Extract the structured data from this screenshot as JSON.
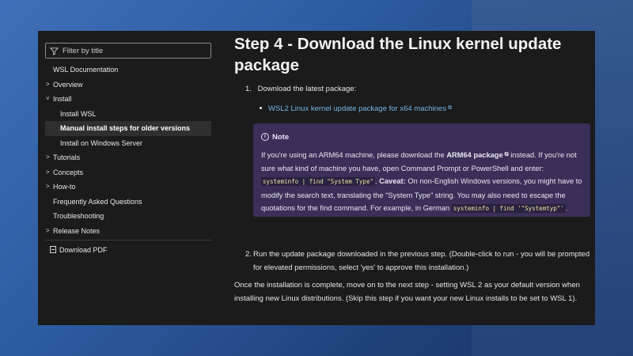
{
  "sidebar": {
    "filter_placeholder": "Filter by title",
    "items": [
      {
        "label": "WSL Documentation"
      },
      {
        "label": "Overview",
        "chev": ">"
      },
      {
        "label": "Install",
        "chev": "˅"
      },
      {
        "label": "Install WSL"
      },
      {
        "label": "Manual install steps for older versions"
      },
      {
        "label": "Install on Windows Server"
      },
      {
        "label": "Tutorials",
        "chev": ">"
      },
      {
        "label": "Concepts",
        "chev": ">"
      },
      {
        "label": "How-to",
        "chev": ">"
      },
      {
        "label": "Frequently Asked Questions"
      },
      {
        "label": "Troubleshooting"
      },
      {
        "label": "Release Notes",
        "chev": ">"
      }
    ],
    "download_label": "Download PDF"
  },
  "content": {
    "title": "Step 4 - Download the Linux kernel update package",
    "step1_num": "1.",
    "step1_text": "Download the latest package:",
    "link_text": "WSL2 Linux kernel update package for x64 machines",
    "ext_icon": "⧉",
    "note": {
      "title": "Note",
      "info_icon": "i",
      "p1": "If you're using an ARM64 machine, please download the ",
      "arm_link": "ARM64 package",
      "p2": " instead. If you're not sure what kind of machine you have, open Command Prompt or PowerShell and enter: ",
      "code1": "systeminfo | find \"System Type\"",
      "p3": ". ",
      "caveat": "Caveat:",
      "p4": " On non-English Windows versions, you might have to modify the search text, translating the \"System Type\" string. You may also need to escape the quotations for the find command. For example, in German ",
      "code2": "systeminfo | find '\"Systemtyp\"'",
      "p5": "."
    },
    "step2_num": "2.",
    "step2_text": "Run the update package downloaded in the previous step. (Double-click to run - you will be prompted for elevated permissions, select 'yes' to approve this installation.)",
    "paragraph": "Once the installation is complete, move on to the next step - setting WSL 2 as your default version when installing new Linux distributions. (Skip this step if you want your new Linux installs to be set to WSL 1)."
  }
}
